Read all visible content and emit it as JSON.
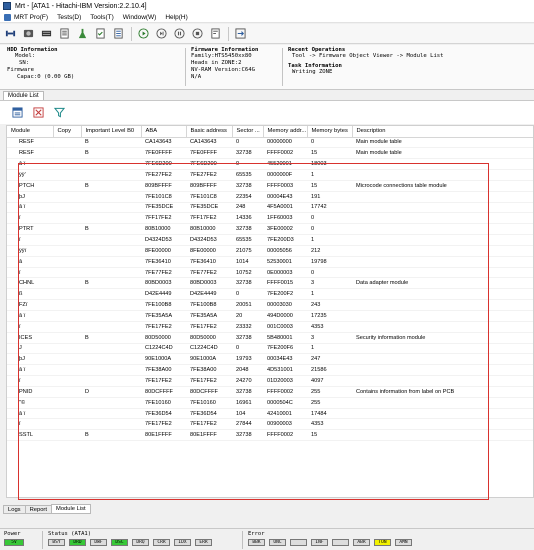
{
  "window": {
    "title": "Mrt - [ATA1 - Hitachi-IBM Version:2.2.10.4]"
  },
  "menu": {
    "items": [
      "MRT Pro(F)",
      "Tests(D)",
      "Tools(T)",
      "Window(W)",
      "Help(H)"
    ]
  },
  "hdd_info": {
    "header": "HDD Information",
    "model": "Model:",
    "sn": "SN:",
    "firmware": "Firmware",
    "capacity": "Capac:0 (0.00 GB)"
  },
  "firmware_info": {
    "header": "Firmware Information",
    "family": "Family:HTS5450xx80",
    "heads": "Heads in ZONE:2",
    "nv_ram": "NV-RAM Version:C64G",
    "na": "N/A"
  },
  "recent_ops": {
    "header": "Recent Operations",
    "path": "Tool -> Firmware Object Viewer -> Module List"
  },
  "task_info": {
    "header": "Task Information",
    "status": "Writing ZONE"
  },
  "module_list_tab": {
    "label": "Module List"
  },
  "table": {
    "columns": [
      "Module",
      "Copy",
      "Important Level B0",
      "ABA",
      "Basic address",
      "Sector ...",
      "Memory addr...",
      "Memory bytes",
      "Description"
    ],
    "rows": [
      [
        "RESF",
        "",
        "B",
        "CA143643",
        "CA143643",
        "0",
        "00000000",
        "0",
        "Main module table"
      ],
      [
        "RESF",
        "",
        "B",
        "7FE0FFFF",
        "7FE0FFFF",
        "32738",
        "FFFF0002",
        "15",
        "Main module table"
      ],
      [
        "â ï",
        "",
        "",
        "7FE6D200",
        "7FE6D200",
        "0",
        "45520001",
        "18003",
        ""
      ],
      [
        "ÿÿ'",
        "",
        "",
        "7FE27FE2",
        "7FE27FE2",
        "65535",
        "0000000F",
        "1",
        ""
      ],
      [
        "PTCH",
        "",
        "B",
        "809BFFFF",
        "809BFFFF",
        "32738",
        "FFFF0003",
        "15",
        "Microcode connections table module"
      ],
      [
        "þJ",
        "",
        "",
        "7FE101C8",
        "7FE101C8",
        "22354",
        "00004E43",
        "191",
        ""
      ],
      [
        "â ï",
        "",
        "",
        "7FE35DCE",
        "7FE35DCE",
        "248",
        "4F5A0001",
        "17742",
        ""
      ],
      [
        "ï",
        "",
        "",
        "7FF17FE2",
        "7FF17FE2",
        "14336",
        "1FF60003",
        "0",
        ""
      ],
      [
        "PTRT",
        "",
        "B",
        "80B10000",
        "80B10000",
        "32738",
        "3FE00002",
        "0",
        ""
      ],
      [
        "ï",
        "",
        "",
        "D4324D53",
        "D4324D53",
        "65535",
        "7FE200D3",
        "1",
        ""
      ],
      [
        "ÿÿï",
        "",
        "",
        "8FE00000",
        "8FE00000",
        "21075",
        "00005056",
        "212",
        ""
      ],
      [
        "â",
        "",
        "",
        "7FE36410",
        "7FE36410",
        "1014",
        "52530001",
        "19798",
        ""
      ],
      [
        "ï",
        "",
        "",
        "7FE77FE2",
        "7FE77FE2",
        "10752",
        "0E000003",
        "0",
        ""
      ],
      [
        "CHNL",
        "",
        "B",
        "80BD0003",
        "80BD0003",
        "32738",
        "FFFF0015",
        "3",
        "Data adapter module"
      ],
      [
        "ß",
        "",
        "",
        "D42E4449",
        "D42E4449",
        "0",
        "7FE200F2",
        "1",
        ""
      ],
      [
        "FZï",
        "",
        "",
        "7FE100B8",
        "7FE100B8",
        "20051",
        "00003030",
        "243",
        ""
      ],
      [
        "â ï",
        "",
        "",
        "7FE35A5A",
        "7FE35A5A",
        "20",
        "494D0000",
        "17235",
        ""
      ],
      [
        "ï",
        "",
        "",
        "7FE17FE2",
        "7FE17FE2",
        "23332",
        "001C0003",
        "4353",
        ""
      ],
      [
        "ICES",
        "",
        "B",
        "80D50000",
        "80D50000",
        "32738",
        "5B480001",
        "3",
        "Security information module"
      ],
      [
        "J",
        "",
        "",
        "C1224C4D",
        "C1224C4D",
        "0",
        "7FE200F6",
        "1",
        ""
      ],
      [
        "þJ",
        "",
        "",
        "90E1000A",
        "90E1000A",
        "19793",
        "00034E43",
        "247",
        ""
      ],
      [
        "â ï",
        "",
        "",
        "7FE38A00",
        "7FE38A00",
        "2048",
        "4D531001",
        "21586",
        ""
      ],
      [
        "ï",
        "",
        "",
        "7FE17FE2",
        "7FE17FE2",
        "24270",
        "01D20003",
        "4097",
        ""
      ],
      [
        "PNID",
        "",
        "D",
        "80DCFFFF",
        "80DCFFFF",
        "32738",
        "FFFF0002",
        "255",
        "Contains information from label on PCB"
      ],
      [
        "\"©",
        "",
        "",
        "7FE10160",
        "7FE10160",
        "16961",
        "0000504C",
        "255",
        ""
      ],
      [
        "â ï",
        "",
        "",
        "7FE36D54",
        "7FE36D54",
        "104",
        "42410001",
        "17484",
        ""
      ],
      [
        "ï",
        "",
        "",
        "7FE17FE2",
        "7FE17FE2",
        "27844",
        "00900003",
        "4353",
        ""
      ],
      [
        "SSTL",
        "",
        "B",
        "80E1FFFF",
        "80E1FFFF",
        "32738",
        "FFFF0002",
        "15",
        ""
      ]
    ]
  },
  "bottom_tabs": [
    "Logs",
    "Report",
    "Module List"
  ],
  "status": {
    "power_label": "Power",
    "power_lamps": [
      "5V"
    ],
    "status_label": "Status (ATA1)",
    "status_lamps": [
      "BSY",
      "DRD",
      "DWF",
      "DSC",
      "DRQ",
      "CRR",
      "IDX",
      "ERR"
    ],
    "error_label": "Error",
    "error_lamps": [
      "BBK",
      "UNC",
      "",
      "INF",
      "",
      "ABR",
      "TON",
      "AMN"
    ]
  },
  "colors": {
    "lamp_green": "#38c838",
    "lamp_yellow": "#f2f200",
    "lamp_off": "#dcdcdc",
    "highlight_red": "#d8322e"
  }
}
